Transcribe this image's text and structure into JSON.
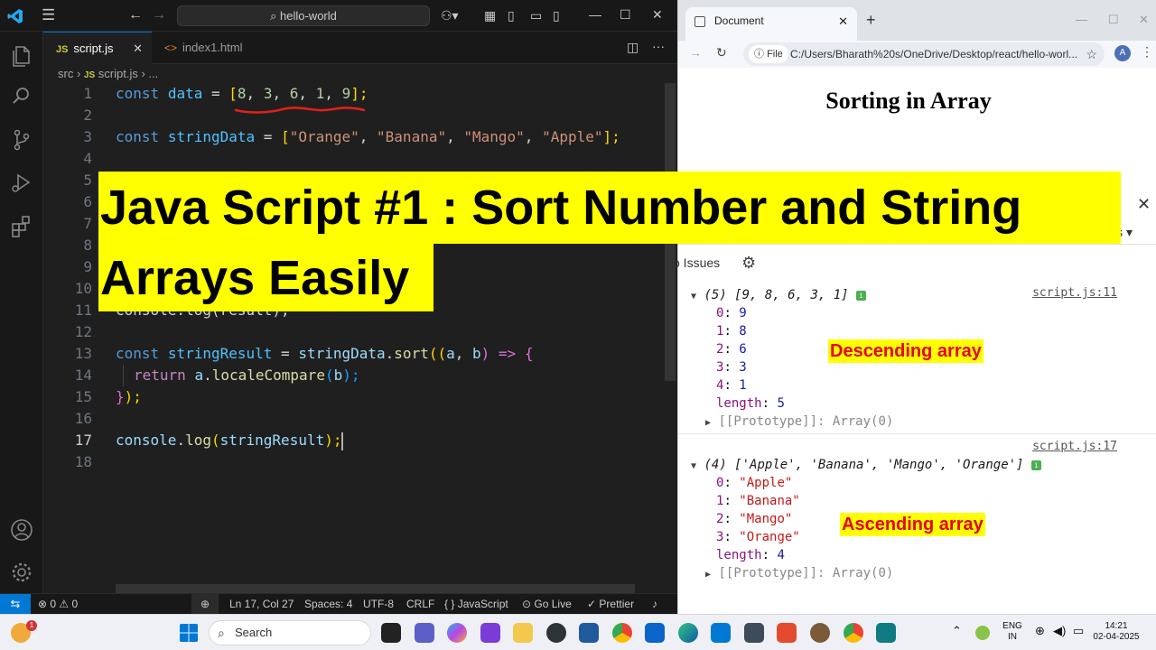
{
  "vscode": {
    "command_center": "hello-world",
    "tabs": [
      {
        "label": "script.js",
        "icon": "JS"
      },
      {
        "label": "index1.html",
        "icon": "<>"
      }
    ],
    "breadcrumb": {
      "folder": "src",
      "file": "script.js",
      "rest": "..."
    },
    "code_lines": [
      "1",
      "2",
      "3",
      "4",
      "5",
      "6",
      "7",
      "8",
      "9",
      "10",
      "11",
      "12",
      "13",
      "14",
      "15",
      "16",
      "17",
      "18"
    ],
    "code": {
      "l1": [
        "const",
        "data",
        "=",
        "[",
        "8",
        ",",
        "3",
        ",",
        "6",
        ",",
        "1",
        ",",
        "9",
        "];"
      ],
      "l3": [
        "const",
        "stringData",
        "=",
        "[",
        "\"Orange\"",
        "\"Banana\"",
        "\"Mango\"",
        "\"Apple\"",
        "];"
      ],
      "l11": "console.log(result);",
      "l13": [
        "const",
        "stringResult",
        "=",
        "stringData",
        ".",
        "sort",
        "((",
        "a",
        "b",
        ") =>",
        "{"
      ],
      "l14": [
        "return",
        "a",
        ".",
        "localeCompare",
        "(",
        "b",
        ");"
      ],
      "l15": [
        "}",
        ");"
      ],
      "l17": [
        "console",
        ".",
        "log",
        "(",
        "stringResult",
        ");"
      ]
    },
    "status": {
      "errors": "0",
      "warnings": "0",
      "position": "Ln 17, Col 27",
      "spaces": "Spaces: 4",
      "encoding": "UTF-8",
      "eol": "CRLF",
      "language": "JavaScript",
      "golive": "Go Live",
      "prettier": "Prettier"
    }
  },
  "banner": {
    "line1": "Java Script #1 : Sort Number and String",
    "line2": "Arrays Easily"
  },
  "browser": {
    "tab_title": "Document",
    "file_chip": "File",
    "url": "C:/Users/Bharath%20s/OneDrive/Desktop/react/hello-worl...",
    "avatar": "A",
    "page_heading": "Sorting in Array",
    "devtools": {
      "elements_partial": "ls",
      "issues": "o Issues",
      "log1": {
        "summary": "(5) [9, 8, 6, 3, 1]",
        "source": "script.js:11",
        "entries": [
          {
            "k": "0",
            "v": "9"
          },
          {
            "k": "1",
            "v": "8"
          },
          {
            "k": "2",
            "v": "6"
          },
          {
            "k": "3",
            "v": "3"
          },
          {
            "k": "4",
            "v": "1"
          }
        ],
        "length": "5",
        "prototype": "[[Prototype]]: Array(0)"
      },
      "log2": {
        "summary": "(4) ['Apple', 'Banana', 'Mango', 'Orange']",
        "source": "script.js:17",
        "entries": [
          {
            "k": "0",
            "v": "\"Apple\""
          },
          {
            "k": "1",
            "v": "\"Banana\""
          },
          {
            "k": "2",
            "v": "\"Mango\""
          },
          {
            "k": "3",
            "v": "\"Orange\""
          }
        ],
        "length": "4",
        "prototype": "[[Prototype]]: Array(0)"
      },
      "annotation_desc": "Descending array",
      "annotation_asc": "Ascending array"
    }
  },
  "taskbar": {
    "search_placeholder": "Search",
    "notification_count": "1",
    "lang1": "ENG",
    "lang2": "IN",
    "time": "14:21",
    "date": "02-04-2025"
  },
  "colors": {
    "accent": "#0078d4",
    "highlight": "#ffff00",
    "annotation_text": "#e8001c",
    "editor_bg": "#1f1f1f"
  }
}
